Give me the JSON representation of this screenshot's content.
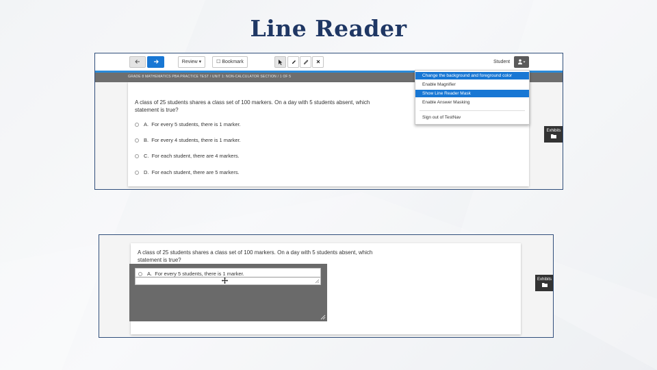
{
  "slide": {
    "title": "Line Reader"
  },
  "shot1": {
    "toolbar": {
      "back_icon": "arrow-left-icon",
      "forward_icon": "arrow-right-icon",
      "review_label": "Review",
      "bookmark_label": "Bookmark",
      "user_label": "Student"
    },
    "breadcrumb": "GRADE 8 MATHEMATICS PBA PRACTICE TEST  /  UNIT 1: NON-CALCULATOR SECTION  /  1 OF 5",
    "question": {
      "stem_line1": "A class of 25 students shares a class set of 100 markers. On a day with 5 students absent, which",
      "stem_line2": "statement is true?",
      "options": [
        {
          "letter": "A.",
          "text": "For every 5 students, there is 1 marker."
        },
        {
          "letter": "B.",
          "text": "For every 4 students, there is 1 marker."
        },
        {
          "letter": "C.",
          "text": "For each student, there are 4 markers."
        },
        {
          "letter": "D.",
          "text": "For each student, there are 5 markers."
        }
      ]
    },
    "menu": {
      "items": [
        "Change the background and foreground color",
        "Enable Magnifier",
        "Show Line Reader Mask",
        "Enable Answer Masking",
        "Sign out of TestNav"
      ]
    },
    "exhibits_label": "Exhibits"
  },
  "shot2": {
    "stem_line1": "A class of 25 students shares a class set of 100 markers. On a day with 5 students absent, which",
    "stem_line2": "statement is true?",
    "option_letter": "A.",
    "option_text": "For every 5 students, there is 1 marker.",
    "exhibits_label": "Exhibits"
  },
  "colors": {
    "accent": "#1877d4",
    "title": "#1f3764",
    "mask": "#6a6a6a"
  }
}
